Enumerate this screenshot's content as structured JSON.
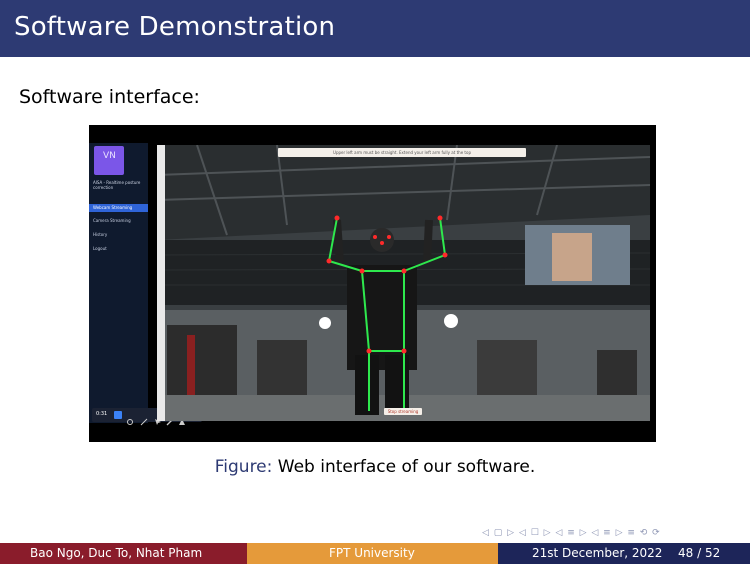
{
  "header": {
    "title": "Software Demonstration"
  },
  "slide": {
    "subheading": "Software interface:"
  },
  "figure": {
    "app": {
      "logo_text": "VN",
      "name": "AISA - Realtime posture correction",
      "nav": [
        "Webcam Streaming",
        "Camera Streaming",
        "History",
        "Logout"
      ],
      "active_nav": "Webcam Streaming"
    },
    "instruction": "Upper left arm must be straight. Extend your left arm fully at the top",
    "stop_button": "Stop streaming",
    "player": {
      "time": "0:31"
    }
  },
  "caption": {
    "label": "Figure:",
    "text": " Web interface of our software."
  },
  "nav_symbols": "◁ ▢ ▷ ◁ ☐ ▷ ◁ ≡ ▷ ◁ ≡ ▷   ≡   ⟲ ⟳",
  "footer": {
    "authors": "Bao Ngo, Duc To, Nhat Pham",
    "institution": "FPT University",
    "date": "21st December, 2022",
    "page": "48 / 52"
  },
  "colors": {
    "title_bg": "#2d3a73",
    "footer_red": "#8a1c2b",
    "footer_orange": "#e59a3a",
    "footer_navy": "#1d2559",
    "pose_green": "#2ee84d",
    "keypoint_red": "#ff2a2a"
  }
}
